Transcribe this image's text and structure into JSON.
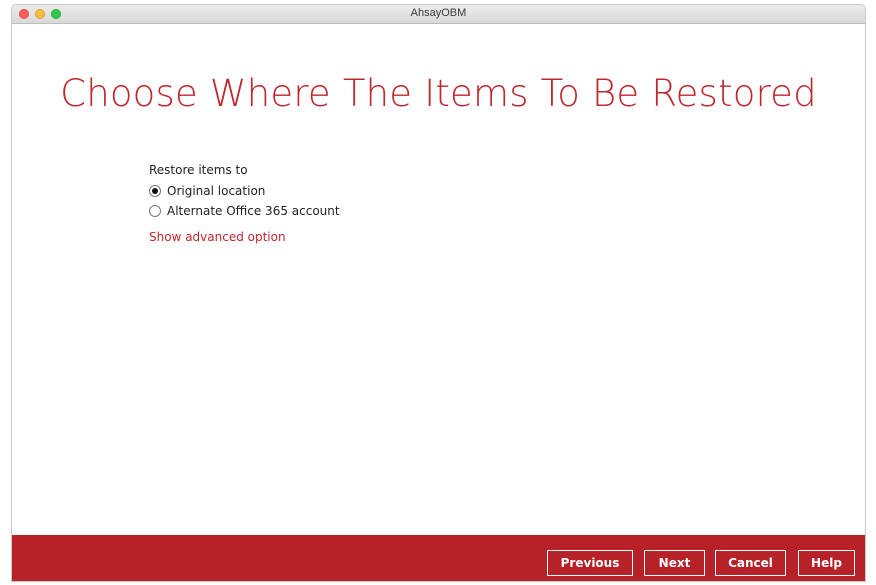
{
  "window": {
    "title": "AhsayOBM"
  },
  "heading": "Choose Where The Items To Be Restored",
  "restore": {
    "label": "Restore items to",
    "options": [
      {
        "label": "Original location",
        "selected": true
      },
      {
        "label": "Alternate Office 365 account",
        "selected": false
      }
    ],
    "advanced_link": "Show advanced option"
  },
  "footer": {
    "previous": "Previous",
    "next": "Next",
    "cancel": "Cancel",
    "help": "Help"
  },
  "colors": {
    "accent": "#c0272d",
    "footer": "#b72228"
  }
}
